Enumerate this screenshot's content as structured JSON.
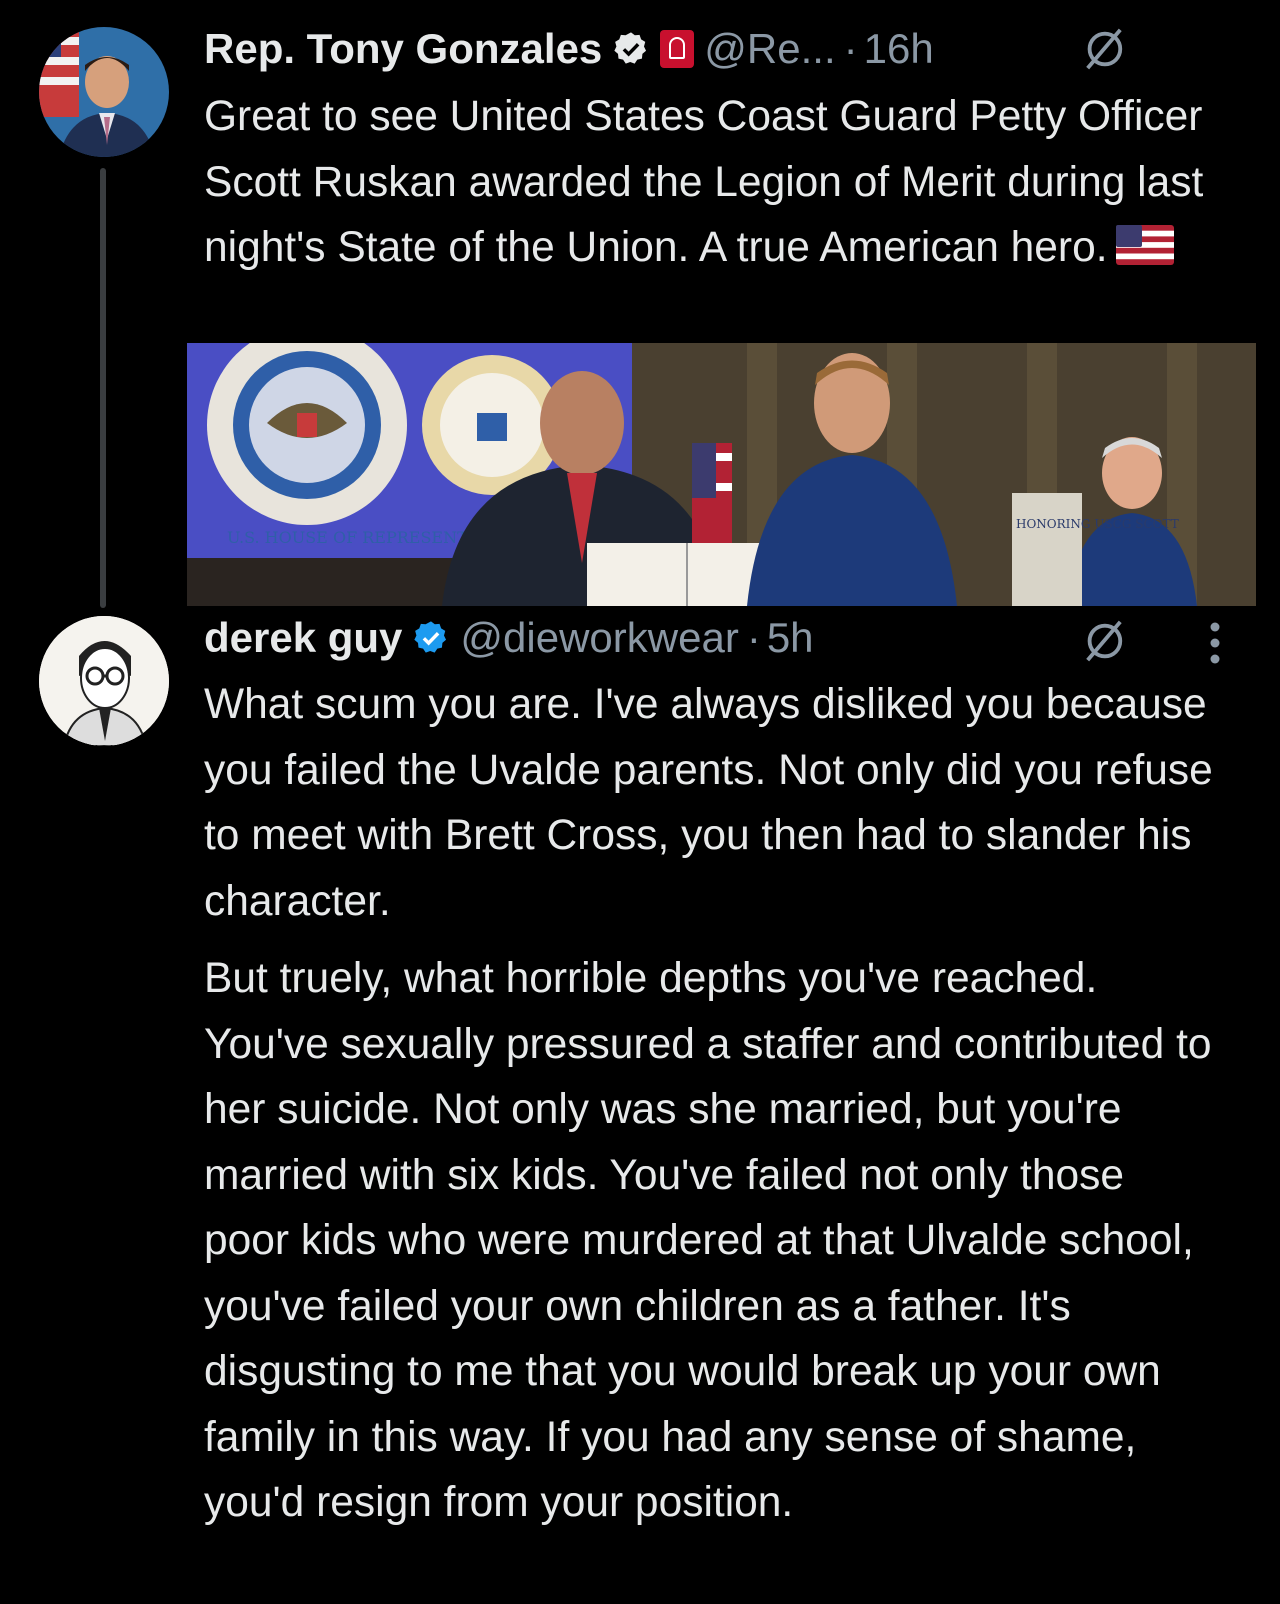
{
  "tweets": [
    {
      "author_name": "Rep. Tony Gonzales",
      "handle": "@Re...",
      "separator": "·",
      "time": "16h",
      "text_paragraphs": [
        "Great to see United States Coast Guard Petty Officer Scott Ruskan awarded the Legion of Merit during last night's State of the Union. A true American hero."
      ],
      "media": {
        "seal_text": "U.S. HOUSE OF REPRESENTATIVES",
        "banner_text": "HONORING USCG SCOTT"
      }
    },
    {
      "author_name": "derek guy",
      "handle": "@dieworkwear",
      "separator": "·",
      "time": "5h",
      "text_paragraphs": [
        "What scum you are. I've always disliked you because you failed the Uvalde parents. Not only did you refuse to meet with Brett Cross, you then had to slander his character.",
        "But truely, what horrible depths you've reached. You've sexually pressured a staffer and contributed to her suicide. Not only was she married, but you're married with six kids. You've failed not only those poor kids who were murdered at that Ulvalde school, you've failed your own children as a father. It's disgusting to me that you would break up your own family in this way. If you had any sense of shame, you'd resign from your position."
      ]
    }
  ],
  "icons": {
    "verified": "verified-badge-icon",
    "government": "government-badge-icon",
    "grok": "grok-icon",
    "more": "more-icon",
    "flag": "us-flag-emoji"
  },
  "colors": {
    "background": "#000000",
    "text": "#e7e9ea",
    "secondary": "#8b98a5",
    "verified": "#1d9bf0"
  }
}
